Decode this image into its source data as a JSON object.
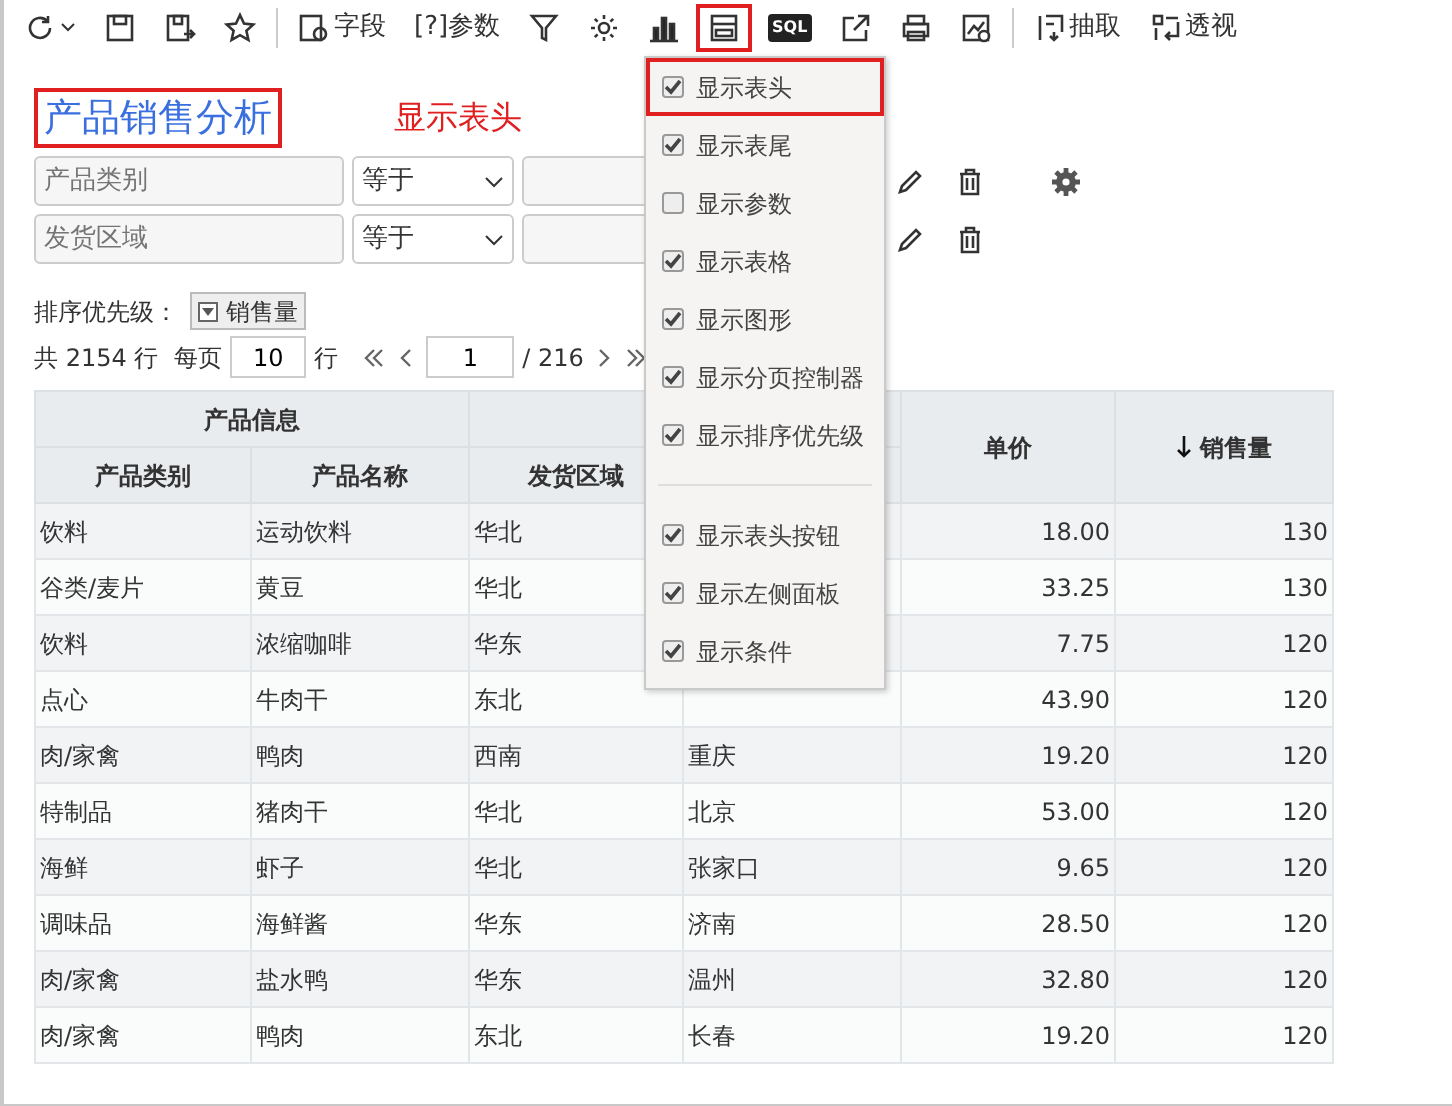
{
  "toolbar": [
    {
      "selected": false
    },
    {
      "selected": false
    },
    {
      "selected": false
    },
    {
      "selected": false
    },
    {
      "label": "字段",
      "selected": false
    },
    {
      "label": "[?]参数",
      "selected": false
    },
    {
      "selected": false
    },
    {
      "selected": false
    },
    {
      "selected": false
    },
    {
      "selected": true
    },
    {
      "label": "SQL",
      "selected": false
    },
    {
      "selected": false
    },
    {
      "selected": false
    },
    {
      "selected": false
    },
    {
      "label": "抽取",
      "selected": false
    },
    {
      "label": "透视",
      "selected": false
    }
  ],
  "title": "产品销售分析",
  "annotation": "显示表头",
  "filters": [
    {
      "placeholder": "产品类别",
      "operator": "等于"
    },
    {
      "placeholder": "发货区域",
      "operator": "等于"
    }
  ],
  "sort": {
    "label": "排序优先级：",
    "field": "销售量"
  },
  "pager": {
    "total": "共 2154 行",
    "per_page_label": "每页",
    "per_page": "10",
    "rows_label": "行",
    "page": "1",
    "page_count": "/ 216"
  },
  "table": {
    "group_headers": [
      {
        "text": "产品信息"
      },
      {
        "text": "单价"
      },
      {
        "text": "销售量",
        "sorted": true
      }
    ],
    "columns": [
      "产品类别",
      "产品名称",
      "发货区域"
    ],
    "rows": [
      [
        "饮料",
        "运动饮料",
        "华北",
        null,
        "18.00",
        "130"
      ],
      [
        "谷类/麦片",
        "黄豆",
        "华北",
        null,
        "33.25",
        "130"
      ],
      [
        "饮料",
        "浓缩咖啡",
        "华东",
        null,
        "7.75",
        "120"
      ],
      [
        "点心",
        "牛肉干",
        "东北",
        null,
        "43.90",
        "120"
      ],
      [
        "肉/家禽",
        "鸭肉",
        "西南",
        "重庆",
        "19.20",
        "120"
      ],
      [
        "特制品",
        "猪肉干",
        "华北",
        "北京",
        "53.00",
        "120"
      ],
      [
        "海鲜",
        "虾子",
        "华北",
        "张家口",
        "9.65",
        "120"
      ],
      [
        "调味品",
        "海鲜酱",
        "华东",
        "济南",
        "28.50",
        "120"
      ],
      [
        "肉/家禽",
        "盐水鸭",
        "华东",
        "温州",
        "32.80",
        "120"
      ],
      [
        "肉/家禽",
        "鸭肉",
        "东北",
        "长春",
        "19.20",
        "120"
      ]
    ]
  },
  "menu": {
    "items": [
      {
        "label": "显示表头",
        "checked": true,
        "selected": true
      },
      {
        "label": "显示表尾",
        "checked": true,
        "selected": false
      },
      {
        "label": "显示参数",
        "checked": false,
        "selected": false
      },
      {
        "label": "显示表格",
        "checked": true,
        "selected": false
      },
      {
        "label": "显示图形",
        "checked": true,
        "selected": false
      },
      {
        "label": "显示分页控制器",
        "checked": true,
        "selected": false
      },
      {
        "label": "显示排序优先级",
        "checked": true,
        "selected": false
      },
      {
        "kind": "separator"
      },
      {
        "label": "显示表头按钮",
        "checked": true,
        "selected": false
      },
      {
        "label": "显示左侧面板",
        "checked": true,
        "selected": false
      },
      {
        "label": "显示条件",
        "checked": true,
        "selected": false
      }
    ]
  }
}
